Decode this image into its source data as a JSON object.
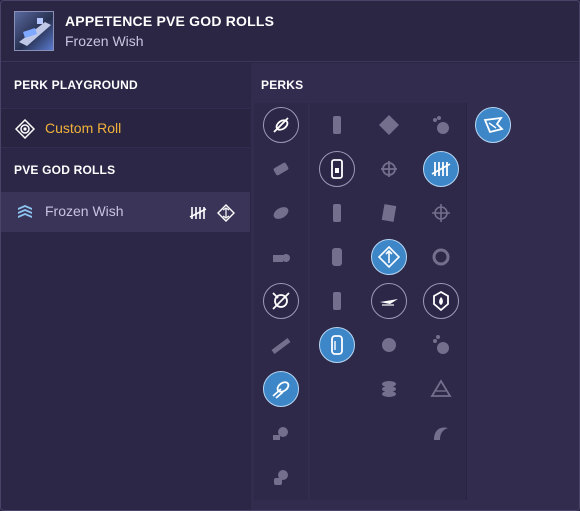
{
  "header": {
    "title": "APPETENCE PVE GOD ROLLS",
    "subtitle": "Frozen Wish",
    "thumbnail_icon": "weapon-thumbnail"
  },
  "sidebar": {
    "playground_heading": "PERK PLAYGROUND",
    "custom_roll_label": "Custom Roll",
    "god_rolls_heading": "PVE GOD ROLLS",
    "rolls": [
      {
        "label": "Frozen Wish",
        "icon": "chevron-rank-icon",
        "tags": [
          "tally-icon",
          "diamond-perk-icon"
        ]
      }
    ],
    "accent_color": "#f0b23a"
  },
  "perks": {
    "heading": "PERKS",
    "columns": [
      {
        "name": "barrels",
        "items": [
          {
            "icon": "barrel-a",
            "state": "outlined"
          },
          {
            "icon": "barrel-b",
            "state": "dim"
          },
          {
            "icon": "barrel-c",
            "state": "dim"
          },
          {
            "icon": "barrel-d",
            "state": "dim"
          },
          {
            "icon": "barrel-e",
            "state": "outlined"
          },
          {
            "icon": "barrel-f",
            "state": "dim"
          },
          {
            "icon": "barrel-g",
            "state": "selected"
          },
          {
            "icon": "barrel-h",
            "state": "dim"
          },
          {
            "icon": "barrel-i",
            "state": "dim"
          }
        ]
      },
      {
        "name": "magazines",
        "items": [
          {
            "icon": "mag-a",
            "state": "dim"
          },
          {
            "icon": "mag-b",
            "state": "outlined"
          },
          {
            "icon": "mag-c",
            "state": "dim"
          },
          {
            "icon": "mag-d",
            "state": "dim"
          },
          {
            "icon": "mag-e",
            "state": "dim"
          },
          {
            "icon": "mag-f",
            "state": "selected"
          }
        ]
      },
      {
        "name": "trait-one",
        "items": [
          {
            "icon": "skull-icon",
            "state": "dim"
          },
          {
            "icon": "crosshair-icon",
            "state": "dim"
          },
          {
            "icon": "card-icon",
            "state": "dim"
          },
          {
            "icon": "arrows-icon",
            "state": "selected"
          },
          {
            "icon": "speed-icon",
            "state": "outlined"
          },
          {
            "icon": "swirl-icon",
            "state": "dim"
          },
          {
            "icon": "coins-icon",
            "state": "dim"
          }
        ]
      },
      {
        "name": "trait-two",
        "items": [
          {
            "icon": "paw-icon",
            "state": "dim"
          },
          {
            "icon": "tally-icon",
            "state": "selected"
          },
          {
            "icon": "target-icon",
            "state": "dim"
          },
          {
            "icon": "ring-icon",
            "state": "dim"
          },
          {
            "icon": "flame-shield-icon",
            "state": "outlined"
          },
          {
            "icon": "paw-icon-2",
            "state": "dim"
          },
          {
            "icon": "triangle-icon",
            "state": "dim"
          },
          {
            "icon": "wave-icon",
            "state": "dim"
          }
        ]
      },
      {
        "name": "origin",
        "items": [
          {
            "icon": "wing-icon",
            "state": "selected"
          }
        ]
      }
    ]
  },
  "colors": {
    "selected": "#3d86c8",
    "background": "#2c2645"
  }
}
